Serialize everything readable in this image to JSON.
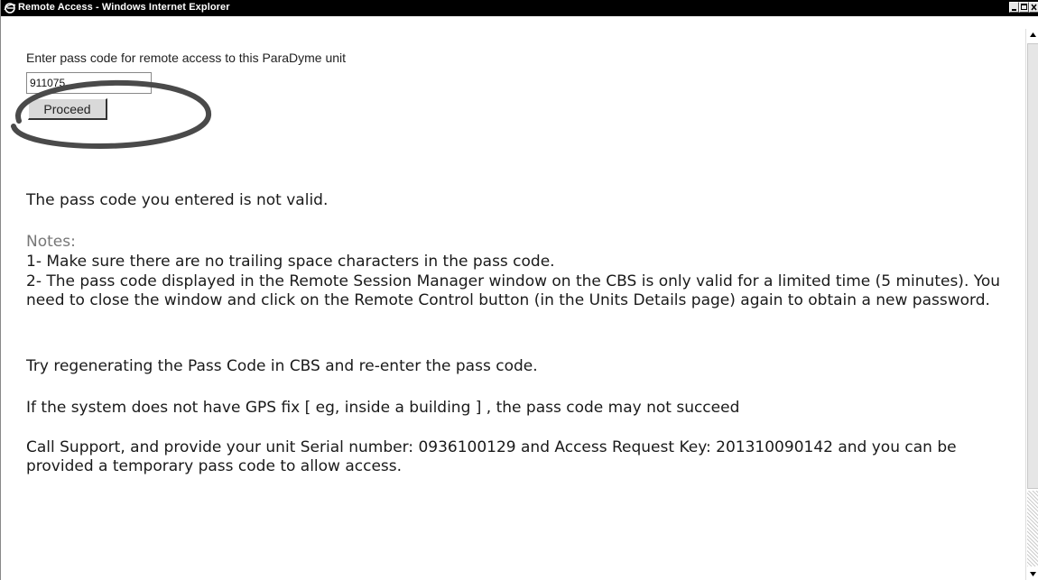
{
  "window": {
    "title": "Remote Access - Windows Internet Explorer"
  },
  "form": {
    "prompt": "Enter pass code for remote access to this ParaDyme unit",
    "pass_code_value": "911075",
    "proceed_label": "Proceed"
  },
  "messages": {
    "error": "The pass code you entered is not valid.",
    "notes_label": "Notes:",
    "note_1": "1- Make sure there are no trailing space characters in the pass code.",
    "note_2": "2- The pass code displayed in the Remote Session Manager window on the CBS is only valid for a limited time (5 minutes). You need to close the window and click on the Remote Control button (in the Units Details page) again to obtain a new password.",
    "retry": "Try regenerating the Pass Code in CBS and re-enter the pass code.",
    "gps": "If the system does not have GPS fix [ eg, inside a building ] , the pass code may not succeed",
    "support": "Call Support, and provide your unit Serial number: 0936100129 and Access Request Key: 201310090142 and you can be provided a temporary pass code to allow access."
  },
  "icons": {
    "browser": "internet-explorer-icon",
    "minimize": "minimize-icon",
    "maximize": "maximize-icon",
    "close": "close-icon",
    "scroll_up": "arrow-up-icon",
    "scroll_down": "arrow-down-icon"
  },
  "colors": {
    "titlebar": "#000000",
    "text": "#1a1a1a",
    "notes_label": "#777777",
    "annotation_ring": "#4a4a4a"
  }
}
